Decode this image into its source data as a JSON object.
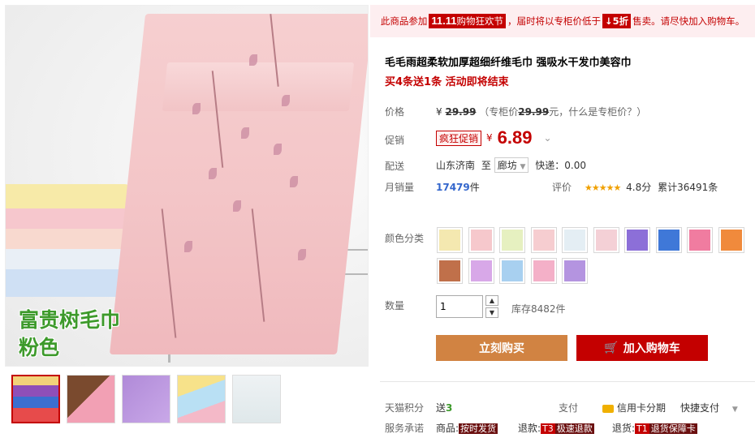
{
  "gallery": {
    "caption_line1": "富贵树毛巾",
    "caption_line2": "粉色",
    "thumbnails": [
      {
        "name": "stack",
        "colors": [
          "#f2d27a",
          "#8f4fb8",
          "#3b6fd0",
          "#e74b4b"
        ]
      },
      {
        "name": "brown-pink",
        "colors": [
          "#7a4a2e",
          "#f2a0b4"
        ]
      },
      {
        "name": "purple",
        "colors": [
          "#b08ad8",
          "#c9a8e8"
        ]
      },
      {
        "name": "pastel",
        "colors": [
          "#f7e28a",
          "#b9e0f4",
          "#f4b9c8"
        ]
      },
      {
        "name": "white-pack",
        "colors": [
          "#eef2f4",
          "#dfe8ea"
        ]
      }
    ]
  },
  "promo_bar": {
    "prefix": "此商品参加",
    "event_num": "11.11",
    "event_name": "购物狂欢节",
    "middle": "，届时将以专柜价低于",
    "discount": "↓5折",
    "suffix": "售卖。请尽快加入购物车。"
  },
  "product": {
    "title": "毛毛雨超柔软加厚超细纤维毛巾 强吸水干发巾美容巾",
    "subtitle": "买4条送1条 活动即将结束"
  },
  "price_row": {
    "label": "价格",
    "currency": "¥",
    "value": "29.99",
    "note_open": "（专柜价",
    "note_price": "29.99",
    "note_close": "元，什么是专柜价？）"
  },
  "promo_row": {
    "label": "促销",
    "tag": "疯狂促销",
    "currency": "¥",
    "price": "6.89",
    "chevron": "⌄"
  },
  "shipping_row": {
    "label": "配送",
    "from": "山东济南",
    "to_label": "至",
    "to_city": "廊坊",
    "fee": "快递：0.00"
  },
  "sales_row": {
    "label": "月销量",
    "count": "17479",
    "unit": "件",
    "rating_label": "评价",
    "stars": "★★★★★",
    "score": "4.8分",
    "reviews": "累计36491条"
  },
  "color_row": {
    "label": "颜色分类",
    "swatches": [
      {
        "color": "#f4e8b0"
      },
      {
        "color": "#f6c8cc"
      },
      {
        "color": "#e6f0c0"
      },
      {
        "color": "#f6cdd0"
      },
      {
        "color": "#e4eef4"
      },
      {
        "color": "#f4d0d6"
      },
      {
        "color": "#8c6fd8"
      },
      {
        "color": "#3f78d8"
      },
      {
        "color": "#f07ca0"
      },
      {
        "color": "#f08a3c"
      },
      {
        "color": "#c0704a"
      },
      {
        "color": "#d8a8e8"
      },
      {
        "color": "#a8d0f0"
      },
      {
        "color": "#f4b0c8"
      },
      {
        "color": "#b494e0"
      }
    ]
  },
  "quantity": {
    "label": "数量",
    "value": "1",
    "up": "▲",
    "down": "▼",
    "stock": "库存8482件"
  },
  "buttons": {
    "buy": "立刻购买",
    "cart": "加入购物车"
  },
  "footer": {
    "points_label": "天猫积分",
    "points_prefix": "送",
    "points_value": "3",
    "pay_label": "支付",
    "pay_card": "信用卡分期",
    "pay_quick": "快捷支付",
    "service_label": "服务承诺",
    "service_goods": "商品:",
    "service_goods_tag": "按时发货",
    "service_return": "退款:",
    "service_return_badge": "T3",
    "service_return_tag": "极速退款",
    "service_exchange": "退货:",
    "service_exchange_badge": "T1",
    "service_exchange_tag": "退货保障卡"
  }
}
